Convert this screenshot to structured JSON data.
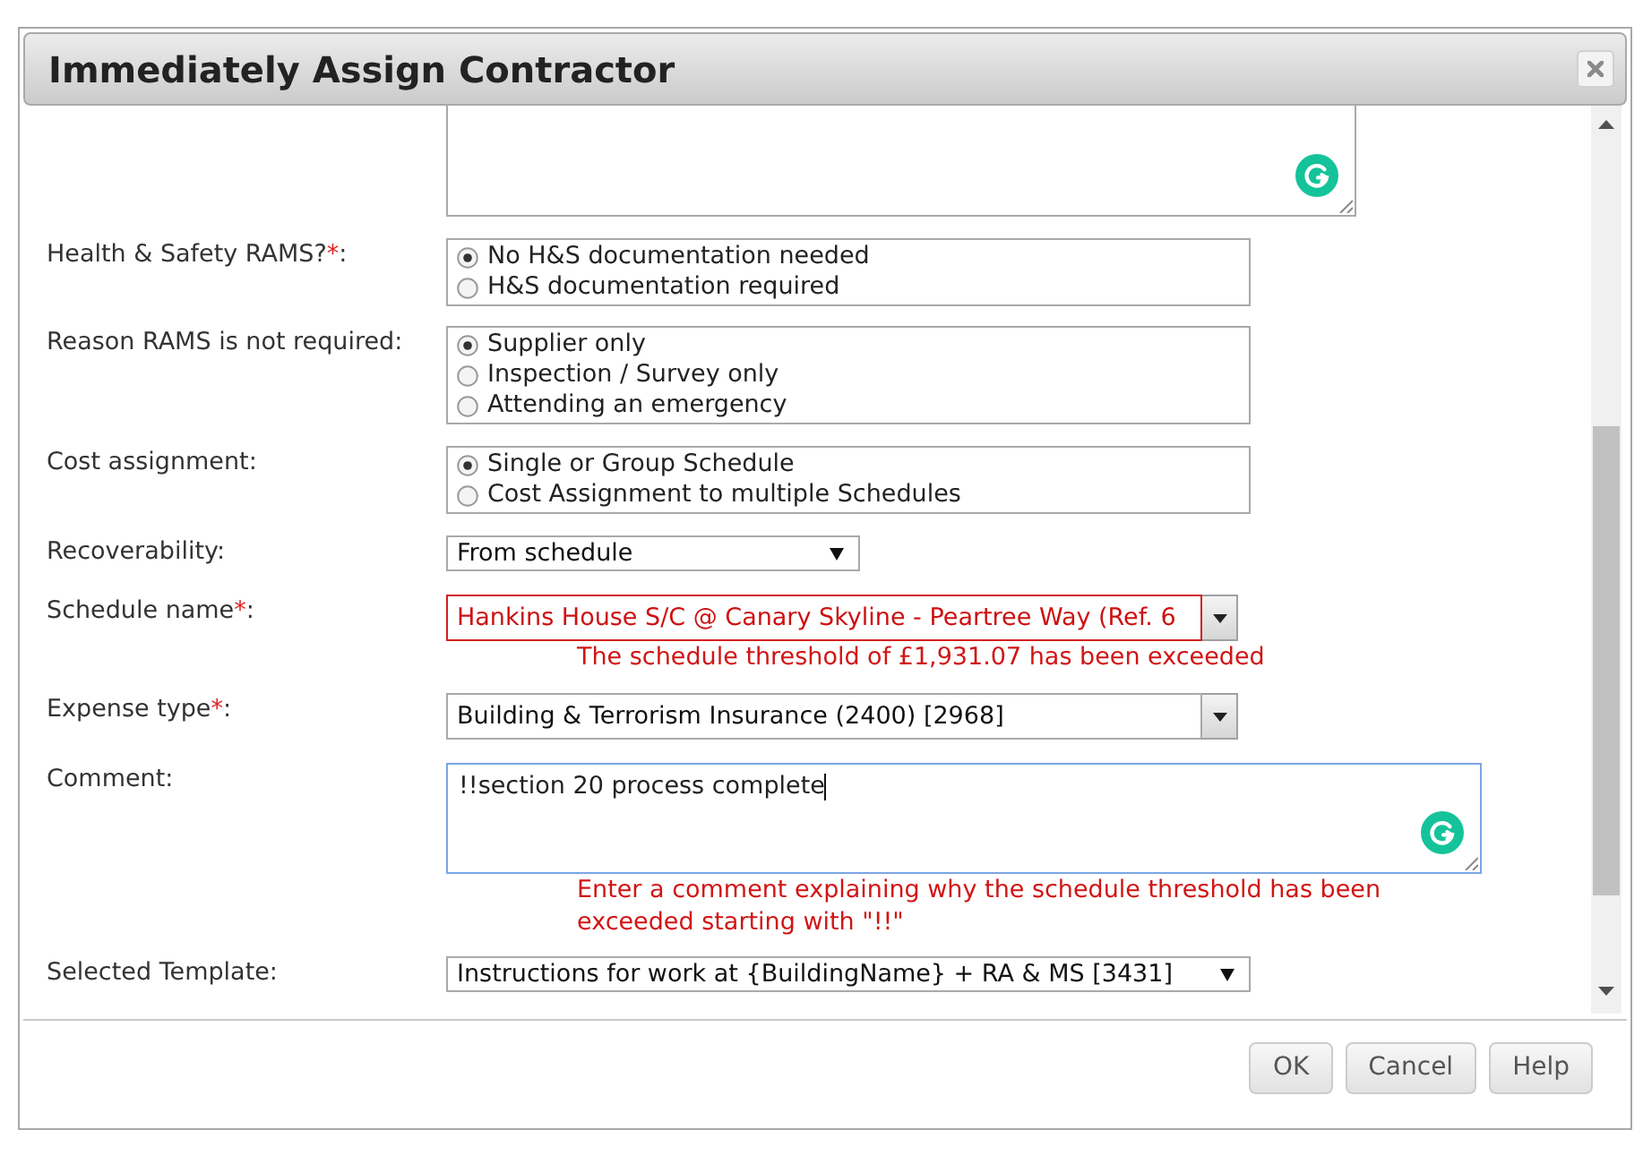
{
  "dialog": {
    "title": "Immediately Assign Contractor"
  },
  "fields": [
    {
      "kind": "textarea",
      "focused": false
    },
    {
      "kind": "radio_group",
      "label": "Health & Safety RAMS?",
      "required_mark": "*",
      "label_suffix": ":",
      "options": [
        {
          "label": "No H&S documentation needed",
          "selected": true
        },
        {
          "label": "H&S documentation required",
          "selected": false
        }
      ]
    },
    {
      "kind": "radio_group",
      "label": "Reason RAMS is not required:",
      "options": [
        {
          "label": "Supplier only",
          "selected": true
        },
        {
          "label": "Inspection / Survey only",
          "selected": false
        },
        {
          "label": "Attending an emergency",
          "selected": false
        }
      ]
    },
    {
      "kind": "radio_group",
      "label": "Cost assignment:",
      "options": [
        {
          "label": "Single or Group Schedule",
          "selected": true
        },
        {
          "label": "Cost Assignment to multiple Schedules",
          "selected": false
        }
      ]
    },
    {
      "kind": "select",
      "label": "Recoverability:",
      "value": "From schedule"
    },
    {
      "kind": "combo",
      "label": "Schedule name",
      "required_mark": "*",
      "label_suffix": ":",
      "value": "Hankins House S/C @ Canary Skyline - Peartree Way (Ref. 6",
      "invalid": true,
      "error": "The schedule threshold of £1,931.07 has been exceeded"
    },
    {
      "kind": "combo",
      "label": "Expense type",
      "required_mark": "*",
      "label_suffix": ":",
      "value": "Building & Terrorism Insurance (2400) [2968]",
      "invalid": false
    },
    {
      "kind": "textarea",
      "label": "Comment:",
      "value": "!!section 20 process complete",
      "focused": true,
      "error": "Enter a comment explaining why the schedule threshold has been exceeded starting with \"!!\""
    },
    {
      "kind": "select",
      "label": "Selected Template:",
      "value": "Instructions for work at {BuildingName} + RA & MS [3431]"
    }
  ],
  "buttons": [
    {
      "label": "OK"
    },
    {
      "label": "Cancel"
    },
    {
      "label": "Help"
    }
  ]
}
